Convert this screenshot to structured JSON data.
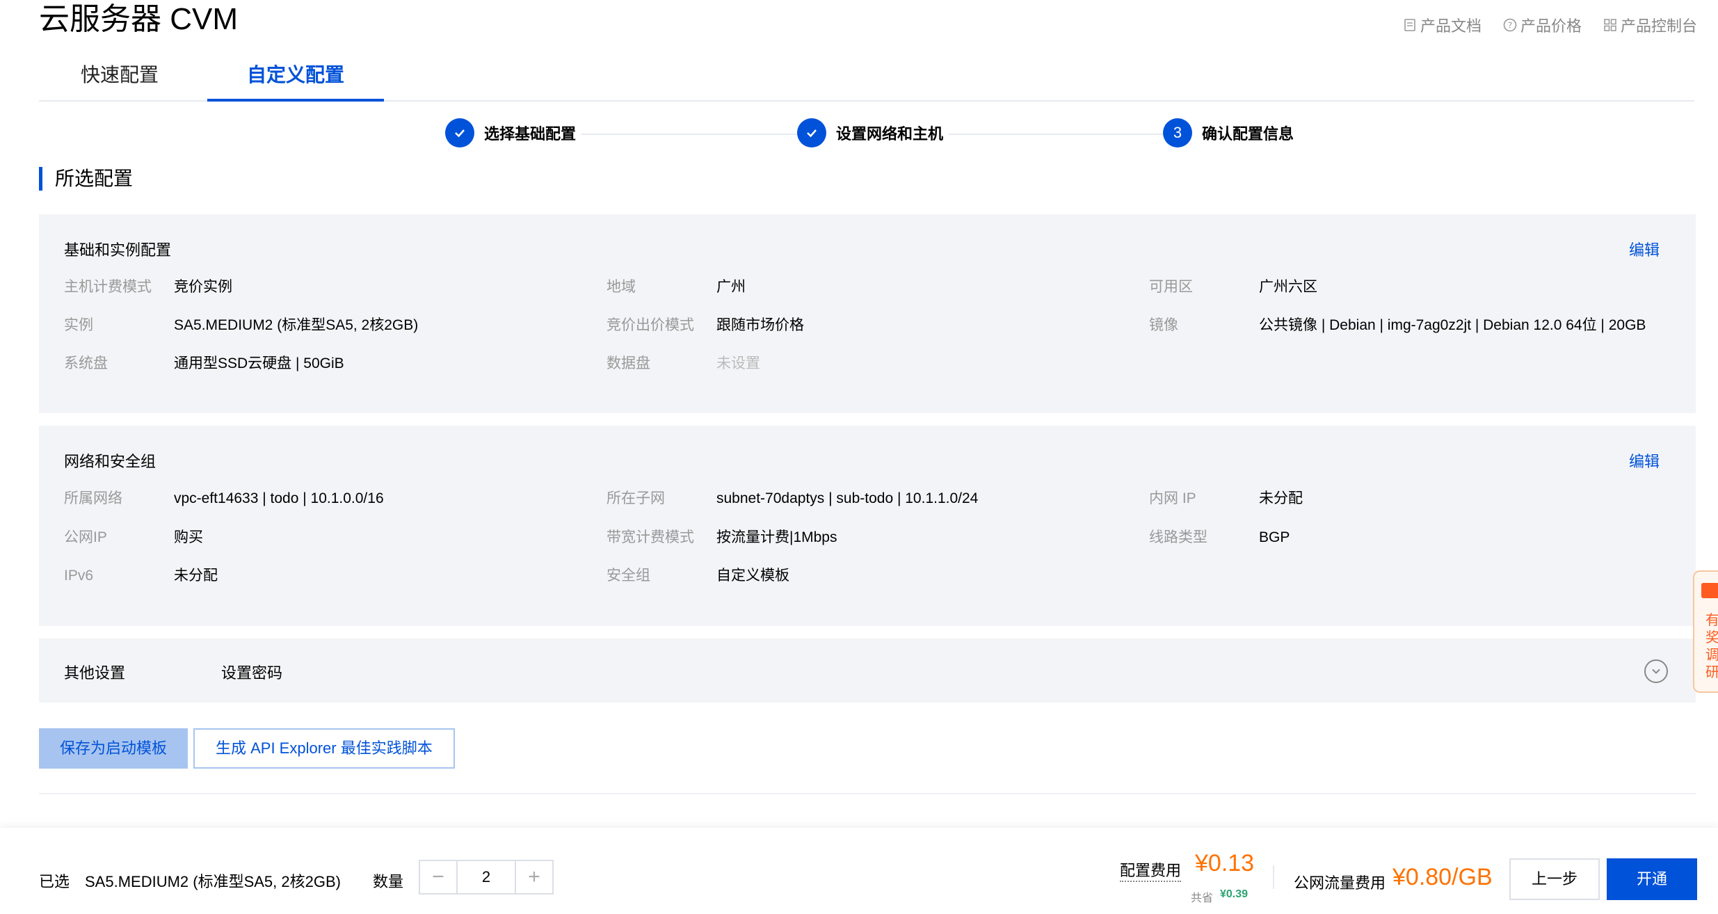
{
  "header": {
    "title": "云服务器 CVM",
    "links": [
      {
        "label": "产品文档",
        "icon": "document-icon"
      },
      {
        "label": "产品价格",
        "icon": "question-circle-icon"
      },
      {
        "label": "产品控制台",
        "icon": "grid-icon"
      }
    ]
  },
  "tabs": [
    {
      "label": "快速配置",
      "active": false
    },
    {
      "label": "自定义配置",
      "active": true
    }
  ],
  "steps": [
    {
      "label": "选择基础配置",
      "status": "done"
    },
    {
      "label": "设置网络和主机",
      "status": "done"
    },
    {
      "number": "3",
      "label": "确认配置信息",
      "status": "current"
    }
  ],
  "section_title": "所选配置",
  "edit_label": "编辑",
  "basic": {
    "title": "基础和实例配置",
    "rows": [
      [
        {
          "label": "主机计费模式",
          "value": "竞价实例"
        },
        {
          "label": "地域",
          "value": "广州"
        },
        {
          "label": "可用区",
          "value": "广州六区"
        }
      ],
      [
        {
          "label": "实例",
          "value": "SA5.MEDIUM2 (标准型SA5, 2核2GB)"
        },
        {
          "label": "竞价出价模式",
          "value": "跟随市场价格"
        },
        {
          "label": "镜像",
          "value": "公共镜像 | Debian | img-7ag0z2jt | Debian 12.0 64位 | 20GB"
        }
      ],
      [
        {
          "label": "系统盘",
          "value": "通用型SSD云硬盘 | 50GiB"
        },
        {
          "label": "数据盘",
          "value": "未设置"
        },
        {
          "label": "",
          "value": ""
        }
      ]
    ]
  },
  "network": {
    "title": "网络和安全组",
    "rows": [
      [
        {
          "label": "所属网络",
          "value": "vpc-eft14633 | todo | 10.1.0.0/16"
        },
        {
          "label": "所在子网",
          "value": "subnet-70daptys | sub-todo | 10.1.1.0/24"
        },
        {
          "label": "内网 IP",
          "value": "未分配"
        }
      ],
      [
        {
          "label": "公网IP",
          "value": "购买"
        },
        {
          "label": "带宽计费模式",
          "value": "按流量计费|1Mbps"
        },
        {
          "label": "线路类型",
          "value": "BGP"
        }
      ],
      [
        {
          "label": "IPv6",
          "value": "未分配"
        },
        {
          "label": "安全组",
          "value": "自定义模板"
        },
        {
          "label": "",
          "value": ""
        }
      ]
    ]
  },
  "other": {
    "title": "其他设置",
    "value": "设置密码"
  },
  "actions": {
    "save_template": "保存为启动模板",
    "api_explorer": "生成 API Explorer 最佳实践脚本"
  },
  "footer": {
    "selected_label": "已选",
    "selected_value": "SA5.MEDIUM2 (标准型SA5, 2核2GB)",
    "quantity_label": "数量",
    "quantity": "2",
    "config_fee_label": "配置费用",
    "config_fee": "¥0.13",
    "saving_label": "共省",
    "saving": "¥0.39",
    "traffic_fee_label": "公网流量费用",
    "traffic_fee": "¥0.80/GB",
    "prev_label": "上一步",
    "submit_label": "开通"
  },
  "side_tab": {
    "text": "有奖调研"
  },
  "colors": {
    "primary": "#0052d9",
    "price": "#ff7200",
    "saving": "#2ba471",
    "panel_bg": "#f3f4f7"
  }
}
